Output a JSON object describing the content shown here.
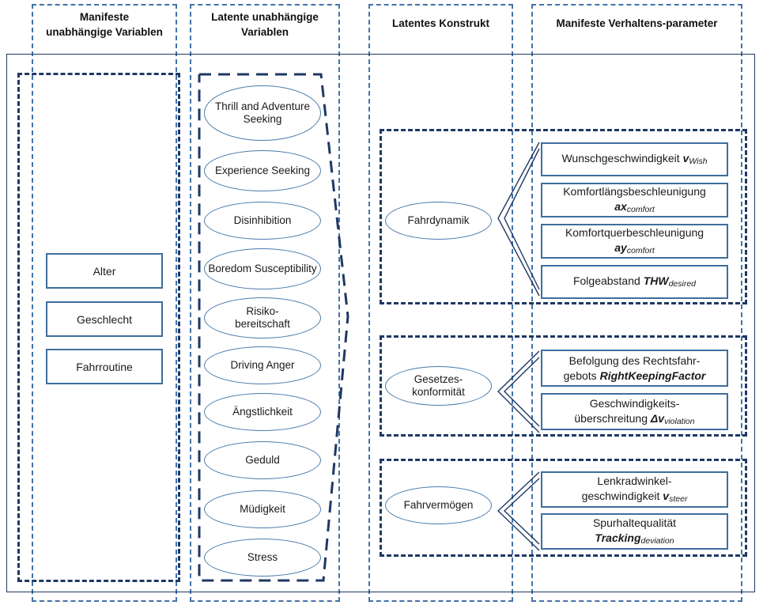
{
  "columns": [
    {
      "name": "manifest-independent",
      "title": "Manifeste\nunabhängige Variablen",
      "line1": "Manifeste",
      "line2": "unabhängige Variablen"
    },
    {
      "name": "latent-independent",
      "title": "Latente unabhängige Variablen",
      "line1": "Latente unabhängige",
      "line2": "Variablen"
    },
    {
      "name": "latent-construct",
      "title": "Latentes Konstrukt",
      "line1": "Latentes Konstrukt",
      "line2": ""
    },
    {
      "name": "manifest-behaviour",
      "title": "Manifeste Verhaltens-parameter",
      "line1": "Manifeste Verhaltens-parameter",
      "line2": ""
    }
  ],
  "manifest_variables": [
    {
      "label": "Alter"
    },
    {
      "label": "Geschlecht"
    },
    {
      "label": "Fahrroutine"
    }
  ],
  "latent_variables": [
    {
      "label": "Thrill and Adventure Seeking"
    },
    {
      "label": "Experience Seeking"
    },
    {
      "label": "Disinhibition"
    },
    {
      "label": "Boredom Susceptibility"
    },
    {
      "label": "Risiko-\nbereitschaft"
    },
    {
      "label": "Driving Anger"
    },
    {
      "label": "Ängstlichkeit"
    },
    {
      "label": "Geduld"
    },
    {
      "label": "Müdigkeit"
    },
    {
      "label": "Stress"
    }
  ],
  "constructs": [
    {
      "name": "fahrdynamik",
      "label": "Fahrdynamik",
      "parameters": [
        {
          "text": "Wunschgeschwindigkeit ",
          "symbol": "v",
          "sub": "Wish"
        },
        {
          "text": "Komfortlängsbeschleunigung",
          "symbol": "ax",
          "sub": "comfort",
          "break": true
        },
        {
          "text": "Komfortquerbeschleunigung",
          "symbol": "ay",
          "sub": "comfort",
          "break": true
        },
        {
          "text": "Folgeabstand ",
          "symbol": "THW",
          "sub": "desired"
        }
      ]
    },
    {
      "name": "gesetzeskonformitaet",
      "label": "Gesetzes-\nkonformität",
      "parameters": [
        {
          "text": "Befolgung des Rechtsfahr-\ngebots ",
          "symbol": "RightKeepingFactor",
          "sub": ""
        },
        {
          "text": "Geschwindigkeits-\nüberschreitung ",
          "symbol": "Δv",
          "sub": "violation"
        }
      ]
    },
    {
      "name": "fahrvermoegen",
      "label": "Fahrvermögen",
      "parameters": [
        {
          "text": "Lenkradwinkel-\ngeschwindigkeit ",
          "symbol": "v",
          "sub": "steer"
        },
        {
          "text": "Spurhaltequalität",
          "symbol": "Tracking",
          "sub": "deviation",
          "break": true
        }
      ]
    }
  ],
  "colors": {
    "navy": "#1F3864",
    "steel": "#3d6e9c",
    "guide": "#4472a8",
    "text": "#1a1a1a"
  }
}
